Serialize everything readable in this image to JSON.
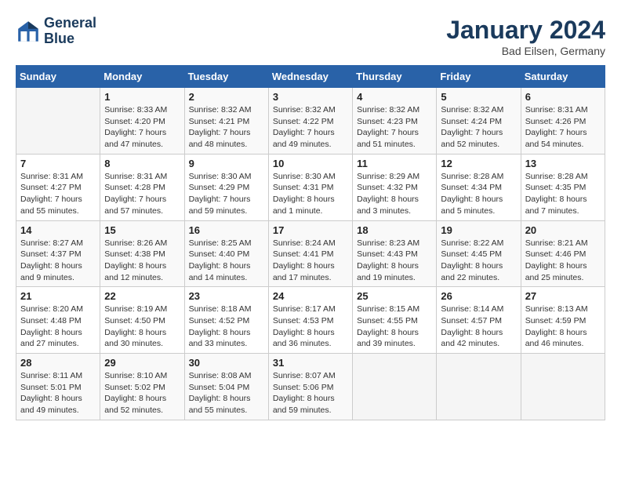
{
  "header": {
    "logo_line1": "General",
    "logo_line2": "Blue",
    "month_title": "January 2024",
    "location": "Bad Eilsen, Germany"
  },
  "weekdays": [
    "Sunday",
    "Monday",
    "Tuesday",
    "Wednesday",
    "Thursday",
    "Friday",
    "Saturday"
  ],
  "weeks": [
    [
      {
        "day": "",
        "sunrise": "",
        "sunset": "",
        "daylight": ""
      },
      {
        "day": "1",
        "sunrise": "Sunrise: 8:33 AM",
        "sunset": "Sunset: 4:20 PM",
        "daylight": "Daylight: 7 hours and 47 minutes."
      },
      {
        "day": "2",
        "sunrise": "Sunrise: 8:32 AM",
        "sunset": "Sunset: 4:21 PM",
        "daylight": "Daylight: 7 hours and 48 minutes."
      },
      {
        "day": "3",
        "sunrise": "Sunrise: 8:32 AM",
        "sunset": "Sunset: 4:22 PM",
        "daylight": "Daylight: 7 hours and 49 minutes."
      },
      {
        "day": "4",
        "sunrise": "Sunrise: 8:32 AM",
        "sunset": "Sunset: 4:23 PM",
        "daylight": "Daylight: 7 hours and 51 minutes."
      },
      {
        "day": "5",
        "sunrise": "Sunrise: 8:32 AM",
        "sunset": "Sunset: 4:24 PM",
        "daylight": "Daylight: 7 hours and 52 minutes."
      },
      {
        "day": "6",
        "sunrise": "Sunrise: 8:31 AM",
        "sunset": "Sunset: 4:26 PM",
        "daylight": "Daylight: 7 hours and 54 minutes."
      }
    ],
    [
      {
        "day": "7",
        "sunrise": "Sunrise: 8:31 AM",
        "sunset": "Sunset: 4:27 PM",
        "daylight": "Daylight: 7 hours and 55 minutes."
      },
      {
        "day": "8",
        "sunrise": "Sunrise: 8:31 AM",
        "sunset": "Sunset: 4:28 PM",
        "daylight": "Daylight: 7 hours and 57 minutes."
      },
      {
        "day": "9",
        "sunrise": "Sunrise: 8:30 AM",
        "sunset": "Sunset: 4:29 PM",
        "daylight": "Daylight: 7 hours and 59 minutes."
      },
      {
        "day": "10",
        "sunrise": "Sunrise: 8:30 AM",
        "sunset": "Sunset: 4:31 PM",
        "daylight": "Daylight: 8 hours and 1 minute."
      },
      {
        "day": "11",
        "sunrise": "Sunrise: 8:29 AM",
        "sunset": "Sunset: 4:32 PM",
        "daylight": "Daylight: 8 hours and 3 minutes."
      },
      {
        "day": "12",
        "sunrise": "Sunrise: 8:28 AM",
        "sunset": "Sunset: 4:34 PM",
        "daylight": "Daylight: 8 hours and 5 minutes."
      },
      {
        "day": "13",
        "sunrise": "Sunrise: 8:28 AM",
        "sunset": "Sunset: 4:35 PM",
        "daylight": "Daylight: 8 hours and 7 minutes."
      }
    ],
    [
      {
        "day": "14",
        "sunrise": "Sunrise: 8:27 AM",
        "sunset": "Sunset: 4:37 PM",
        "daylight": "Daylight: 8 hours and 9 minutes."
      },
      {
        "day": "15",
        "sunrise": "Sunrise: 8:26 AM",
        "sunset": "Sunset: 4:38 PM",
        "daylight": "Daylight: 8 hours and 12 minutes."
      },
      {
        "day": "16",
        "sunrise": "Sunrise: 8:25 AM",
        "sunset": "Sunset: 4:40 PM",
        "daylight": "Daylight: 8 hours and 14 minutes."
      },
      {
        "day": "17",
        "sunrise": "Sunrise: 8:24 AM",
        "sunset": "Sunset: 4:41 PM",
        "daylight": "Daylight: 8 hours and 17 minutes."
      },
      {
        "day": "18",
        "sunrise": "Sunrise: 8:23 AM",
        "sunset": "Sunset: 4:43 PM",
        "daylight": "Daylight: 8 hours and 19 minutes."
      },
      {
        "day": "19",
        "sunrise": "Sunrise: 8:22 AM",
        "sunset": "Sunset: 4:45 PM",
        "daylight": "Daylight: 8 hours and 22 minutes."
      },
      {
        "day": "20",
        "sunrise": "Sunrise: 8:21 AM",
        "sunset": "Sunset: 4:46 PM",
        "daylight": "Daylight: 8 hours and 25 minutes."
      }
    ],
    [
      {
        "day": "21",
        "sunrise": "Sunrise: 8:20 AM",
        "sunset": "Sunset: 4:48 PM",
        "daylight": "Daylight: 8 hours and 27 minutes."
      },
      {
        "day": "22",
        "sunrise": "Sunrise: 8:19 AM",
        "sunset": "Sunset: 4:50 PM",
        "daylight": "Daylight: 8 hours and 30 minutes."
      },
      {
        "day": "23",
        "sunrise": "Sunrise: 8:18 AM",
        "sunset": "Sunset: 4:52 PM",
        "daylight": "Daylight: 8 hours and 33 minutes."
      },
      {
        "day": "24",
        "sunrise": "Sunrise: 8:17 AM",
        "sunset": "Sunset: 4:53 PM",
        "daylight": "Daylight: 8 hours and 36 minutes."
      },
      {
        "day": "25",
        "sunrise": "Sunrise: 8:15 AM",
        "sunset": "Sunset: 4:55 PM",
        "daylight": "Daylight: 8 hours and 39 minutes."
      },
      {
        "day": "26",
        "sunrise": "Sunrise: 8:14 AM",
        "sunset": "Sunset: 4:57 PM",
        "daylight": "Daylight: 8 hours and 42 minutes."
      },
      {
        "day": "27",
        "sunrise": "Sunrise: 8:13 AM",
        "sunset": "Sunset: 4:59 PM",
        "daylight": "Daylight: 8 hours and 46 minutes."
      }
    ],
    [
      {
        "day": "28",
        "sunrise": "Sunrise: 8:11 AM",
        "sunset": "Sunset: 5:01 PM",
        "daylight": "Daylight: 8 hours and 49 minutes."
      },
      {
        "day": "29",
        "sunrise": "Sunrise: 8:10 AM",
        "sunset": "Sunset: 5:02 PM",
        "daylight": "Daylight: 8 hours and 52 minutes."
      },
      {
        "day": "30",
        "sunrise": "Sunrise: 8:08 AM",
        "sunset": "Sunset: 5:04 PM",
        "daylight": "Daylight: 8 hours and 55 minutes."
      },
      {
        "day": "31",
        "sunrise": "Sunrise: 8:07 AM",
        "sunset": "Sunset: 5:06 PM",
        "daylight": "Daylight: 8 hours and 59 minutes."
      },
      {
        "day": "",
        "sunrise": "",
        "sunset": "",
        "daylight": ""
      },
      {
        "day": "",
        "sunrise": "",
        "sunset": "",
        "daylight": ""
      },
      {
        "day": "",
        "sunrise": "",
        "sunset": "",
        "daylight": ""
      }
    ]
  ]
}
